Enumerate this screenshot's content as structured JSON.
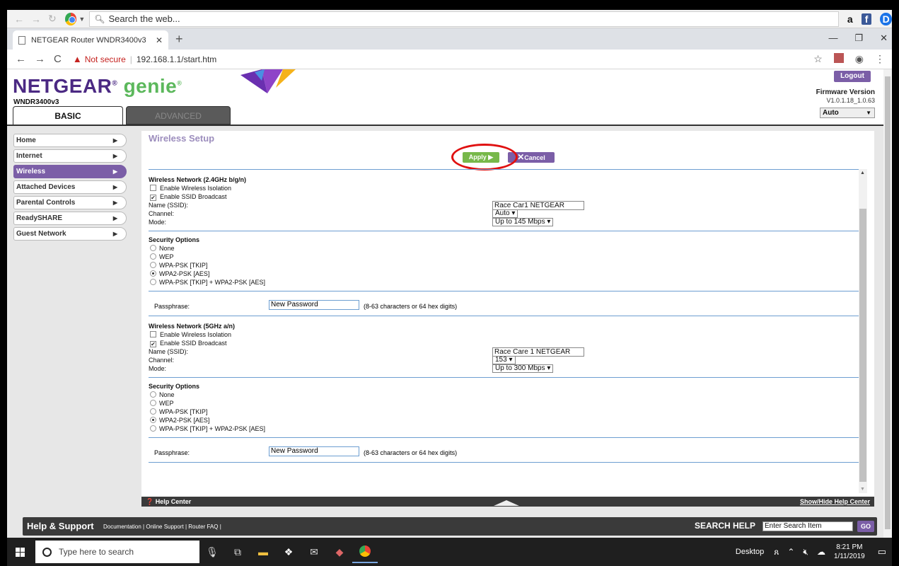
{
  "browser": {
    "search_placeholder": "Search the web...",
    "tab_title": "NETGEAR Router WNDR3400v3",
    "not_secure": "Not secure",
    "url": "192.168.1.1/start.htm",
    "ext_amazon": "a",
    "ext_facebook": "f",
    "ext_d": "D"
  },
  "header": {
    "brand": "NETGEAR",
    "reg": "®",
    "product": "genie",
    "model": "WNDR3400v3",
    "logout_label": "Logout",
    "firmware_label": "Firmware Version",
    "firmware_value": "V1.0.1.18_1.0.63",
    "language_value": "Auto",
    "tab_basic": "BASIC",
    "tab_advanced": "ADVANCED"
  },
  "sidebar": {
    "items": [
      {
        "label": "Home"
      },
      {
        "label": "Internet"
      },
      {
        "label": "Wireless"
      },
      {
        "label": "Attached Devices"
      },
      {
        "label": "Parental Controls"
      },
      {
        "label": "ReadySHARE"
      },
      {
        "label": "Guest Network"
      }
    ]
  },
  "content": {
    "title": "Wireless Setup",
    "apply_label": "Apply",
    "cancel_label": "Cancel"
  },
  "net24": {
    "heading": "Wireless Network (2.4GHz b/g/n)",
    "isolation_label": "Enable Wireless Isolation",
    "ssid_broadcast_label": "Enable SSID Broadcast",
    "ssid_label": "Name (SSID):",
    "ssid_value": "Race Car1 NETGEAR",
    "channel_label": "Channel:",
    "channel_value": "Auto",
    "mode_label": "Mode:",
    "mode_value": "Up to 145 Mbps",
    "security_heading": "Security Options",
    "options": [
      "None",
      "WEP",
      "WPA-PSK [TKIP]",
      "WPA2-PSK [AES]",
      "WPA-PSK [TKIP] + WPA2-PSK [AES]"
    ],
    "selected": "WPA2-PSK [AES]",
    "passphrase_label": "Passphrase:",
    "passphrase_value": "New Password",
    "passphrase_hint": "(8-63 characters or 64 hex digits)"
  },
  "net5": {
    "heading": "Wireless Network (5GHz a/n)",
    "isolation_label": "Enable Wireless Isolation",
    "ssid_broadcast_label": "Enable SSID Broadcast",
    "ssid_label": "Name (SSID):",
    "ssid_value": "Race Care 1 NETGEAR",
    "channel_label": "Channel:",
    "channel_value": "153",
    "mode_label": "Mode:",
    "mode_value": "Up to 300 Mbps",
    "security_heading": "Security Options",
    "options": [
      "None",
      "WEP",
      "WPA-PSK [TKIP]",
      "WPA2-PSK [AES]",
      "WPA-PSK [TKIP] + WPA2-PSK [AES]"
    ],
    "selected": "WPA2-PSK [AES]",
    "passphrase_label": "Passphrase:",
    "passphrase_value": "New Password",
    "passphrase_hint": "(8-63 characters or 64 hex digits)"
  },
  "help_center": {
    "label": "Help Center",
    "toggle_label": "Show/Hide Help Center"
  },
  "help_support": {
    "title": "Help & Support",
    "link_docs": "Documentation",
    "link_support": "Online Support",
    "link_faq": "Router FAQ",
    "search_label": "SEARCH HELP",
    "search_value": "Enter Search Item",
    "go_label": "GO"
  },
  "taskbar": {
    "search_placeholder": "Type here to search",
    "desktop_label": "Desktop",
    "time": "8:21 PM",
    "date": "1/11/2019"
  },
  "colors": {
    "netgear_purple": "#4b2983",
    "genie_green": "#5cb85c",
    "accent_purple": "#7b5ea7",
    "apply_green": "#77b84a",
    "highlight_red": "#e01010"
  }
}
